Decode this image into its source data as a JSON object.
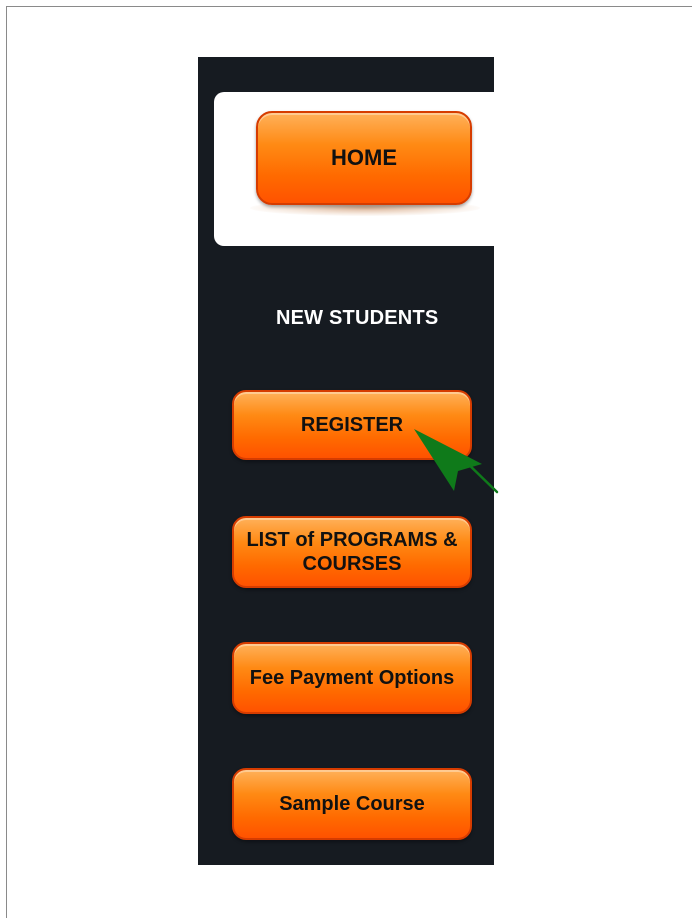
{
  "sidebar": {
    "home_label": "HOME",
    "section_heading": "NEW STUDENTS",
    "buttons": {
      "register": "REGISTER",
      "programs": "LIST of PROGRAMS & COURSES",
      "fee": "Fee Payment Options",
      "sample": "Sample Course"
    }
  },
  "colors": {
    "sidebar_bg": "#161b21",
    "button_orange": "#ff6a00",
    "button_border": "#d63c00",
    "pointer_green": "#0f7a1a"
  },
  "icons": {
    "pointer": "arrow-pointer-icon"
  }
}
